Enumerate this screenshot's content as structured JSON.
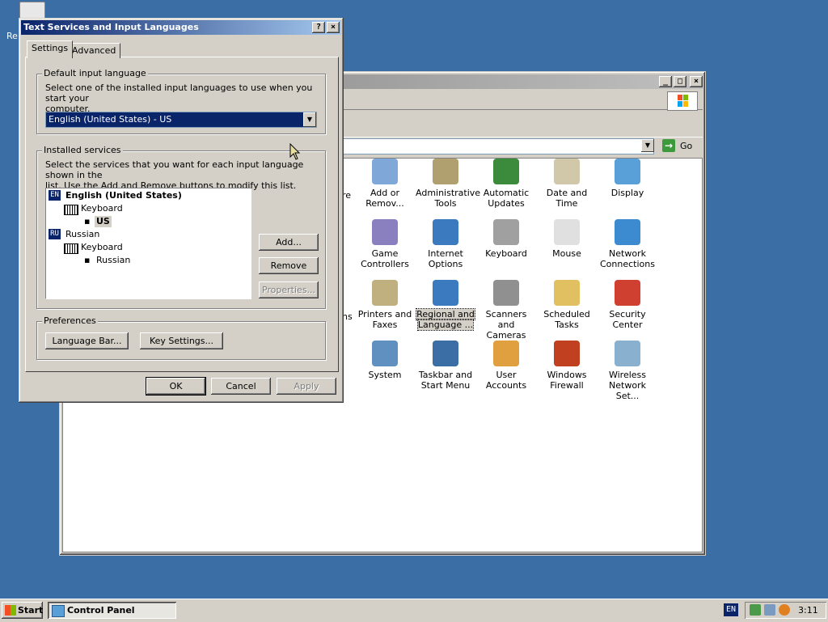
{
  "desktop": {
    "recycle_label": "Re"
  },
  "control_panel": {
    "go_label": "Go",
    "partial_labels": [
      "re",
      "ns"
    ],
    "items": [
      {
        "id": "add-remove",
        "label1": "Add or",
        "label2": "Remov...",
        "color": "#7fa8d8"
      },
      {
        "id": "admin-tools",
        "label1": "Administrative",
        "label2": "Tools",
        "color": "#b0a070"
      },
      {
        "id": "auto-updates",
        "label1": "Automatic",
        "label2": "Updates",
        "color": "#3c8a3c"
      },
      {
        "id": "date-time",
        "label1": "Date and Time",
        "label2": "",
        "color": "#d0c8a8"
      },
      {
        "id": "display",
        "label1": "Display",
        "label2": "",
        "color": "#5aa0d8"
      },
      {
        "id": "game-controllers",
        "label1": "Game",
        "label2": "Controllers",
        "color": "#8a80c0"
      },
      {
        "id": "internet-options",
        "label1": "Internet",
        "label2": "Options",
        "color": "#3c7ac0"
      },
      {
        "id": "keyboard",
        "label1": "Keyboard",
        "label2": "",
        "color": "#a0a0a0"
      },
      {
        "id": "mouse",
        "label1": "Mouse",
        "label2": "",
        "color": "#e0e0e0"
      },
      {
        "id": "network-connections",
        "label1": "Network",
        "label2": "Connections",
        "color": "#3c8ad0"
      },
      {
        "id": "printers-faxes",
        "label1": "Printers and",
        "label2": "Faxes",
        "color": "#c0b080"
      },
      {
        "id": "regional-language",
        "label1": "Regional and",
        "label2": "Language ...",
        "color": "#3c7ac0"
      },
      {
        "id": "scanners-cameras",
        "label1": "Scanners and",
        "label2": "Cameras",
        "color": "#909090"
      },
      {
        "id": "scheduled-tasks",
        "label1": "Scheduled",
        "label2": "Tasks",
        "color": "#e0c060"
      },
      {
        "id": "security-center",
        "label1": "Security",
        "label2": "Center",
        "color": "#d04030"
      },
      {
        "id": "system",
        "label1": "System",
        "label2": "",
        "color": "#6090c0"
      },
      {
        "id": "taskbar-start",
        "label1": "Taskbar and",
        "label2": "Start Menu",
        "color": "#3a6ea5"
      },
      {
        "id": "user-accounts",
        "label1": "User Accounts",
        "label2": "",
        "color": "#e0a040"
      },
      {
        "id": "windows-firewall",
        "label1": "Windows",
        "label2": "Firewall",
        "color": "#c04020"
      },
      {
        "id": "wireless-network",
        "label1": "Wireless",
        "label2": "Network Set...",
        "color": "#8ab0d0"
      }
    ]
  },
  "dialog": {
    "title": "Text Services and Input Languages",
    "help_btn": "?",
    "close_btn": "×",
    "tabs": [
      "Settings",
      "Advanced"
    ],
    "default_group": {
      "title": "Default input language",
      "desc_line1": "Select one of the installed input languages to use when you start your",
      "desc_line2": "computer.",
      "selected_value": "English (United States) - US"
    },
    "installed_group": {
      "title": "Installed services",
      "desc_line1": "Select the services that you want for each input language shown in the",
      "desc_line2": "list. Use the Add and Remove buttons to modify this list.",
      "tree": {
        "lang1_badge": "EN",
        "lang1_name": "English (United States)",
        "lang1_service": "Keyboard",
        "lang1_layout": "US",
        "lang2_badge": "RU",
        "lang2_name": "Russian",
        "lang2_service": "Keyboard",
        "lang2_layout": "Russian"
      },
      "add_btn": "Add...",
      "remove_btn": "Remove",
      "properties_btn": "Properties..."
    },
    "preferences_group": {
      "title": "Preferences",
      "language_bar_btn": "Language Bar...",
      "key_settings_btn": "Key Settings..."
    },
    "ok_btn": "OK",
    "cancel_btn": "Cancel",
    "apply_btn": "Apply"
  },
  "taskbar": {
    "start_label": "Start",
    "task_label": "Control Panel",
    "tray_lang": "EN",
    "clock": "3:11"
  }
}
